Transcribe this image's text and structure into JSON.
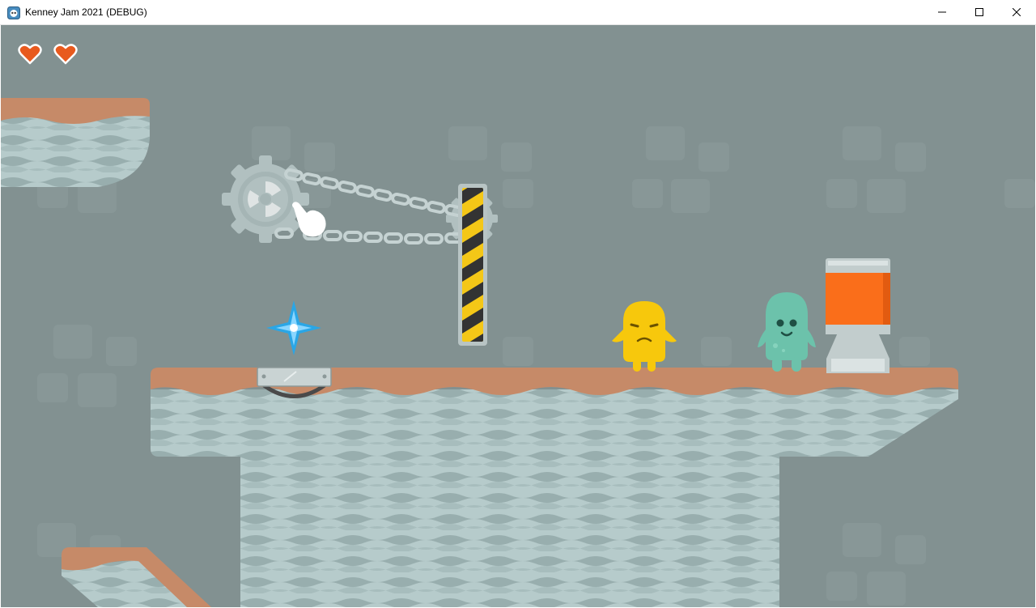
{
  "window": {
    "title": "Kenney Jam 2021 (DEBUG)",
    "controls": [
      "minimize",
      "maximize",
      "close"
    ]
  },
  "hud": {
    "hearts": 2,
    "heart_color": "#e85a1e"
  },
  "colors": {
    "background": "#829191",
    "ground_top": "#c68a68",
    "stone": "#b6cbcb",
    "stone_wave": "#98aeae",
    "barrel_liquid": "#fa6e1a",
    "gem": "#2aa6e6",
    "yellow_character": "#f7c80c",
    "green_character": "#6cc2ab",
    "hazard_yellow": "#f4c717",
    "hazard_black": "#333333"
  },
  "icons": {
    "app": "godot-icon",
    "minimize": "minimize-icon",
    "maximize": "maximize-icon",
    "close": "close-icon",
    "heart": "heart-icon",
    "pointer": "hand-pointer-icon"
  }
}
